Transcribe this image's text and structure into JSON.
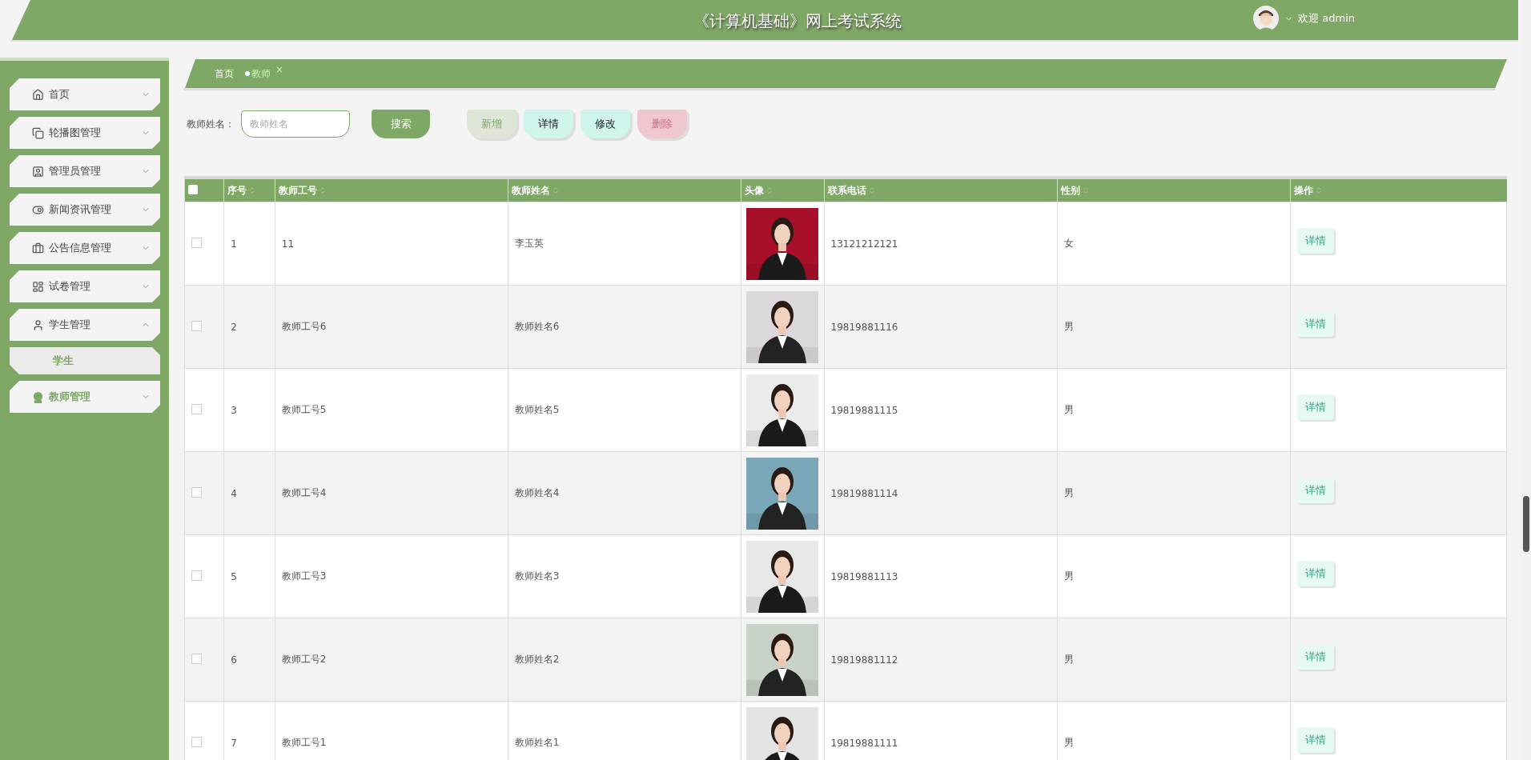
{
  "header": {
    "title": "《计算机基础》网上考试系统",
    "greeting": "欢迎 admin"
  },
  "sidebar": {
    "items": [
      {
        "label": "首页",
        "expanded": false,
        "selected": false
      },
      {
        "label": "轮播图管理",
        "expanded": false,
        "selected": false
      },
      {
        "label": "管理员管理",
        "expanded": false,
        "selected": false
      },
      {
        "label": "新闻资讯管理",
        "expanded": false,
        "selected": false
      },
      {
        "label": "公告信息管理",
        "expanded": false,
        "selected": false
      },
      {
        "label": "试卷管理",
        "expanded": false,
        "selected": false
      },
      {
        "label": "学生管理",
        "expanded": true,
        "selected": false,
        "children": [
          {
            "label": "学生",
            "selected": true
          }
        ]
      },
      {
        "label": "教师管理",
        "expanded": false,
        "selected": true
      }
    ]
  },
  "breadcrumb": [
    {
      "label": "首页",
      "selected": false
    },
    {
      "label": "教师",
      "selected": true,
      "close": "×"
    }
  ],
  "search": {
    "label": "教师姓名：",
    "placeholder": "教师姓名",
    "button": "搜索"
  },
  "actions": [
    {
      "label": "新增",
      "kind": "add"
    },
    {
      "label": "详情",
      "kind": "detail"
    },
    {
      "label": "修改",
      "kind": "edit"
    },
    {
      "label": "删除",
      "kind": "delete"
    }
  ],
  "table": {
    "all_checked": false,
    "columns": [
      "序号",
      "教师工号",
      "教师姓名",
      "头像",
      "联系电话",
      "性别",
      "操作"
    ],
    "rows": [
      {
        "index": "1",
        "id": "11",
        "name": "李玉英",
        "phone": "13121212121",
        "gender": "女",
        "action": "详情",
        "checked": false
      },
      {
        "index": "2",
        "id": "教师工号6",
        "name": "教师姓名6",
        "phone": "19819881116",
        "gender": "男",
        "action": "详情",
        "checked": false
      },
      {
        "index": "3",
        "id": "教师工号5",
        "name": "教师姓名5",
        "phone": "19819881115",
        "gender": "男",
        "action": "详情",
        "checked": false
      },
      {
        "index": "4",
        "id": "教师工号4",
        "name": "教师姓名4",
        "phone": "19819881114",
        "gender": "男",
        "action": "详情",
        "checked": false
      },
      {
        "index": "5",
        "id": "教师工号3",
        "name": "教师姓名3",
        "phone": "19819881113",
        "gender": "男",
        "action": "详情",
        "checked": false
      },
      {
        "index": "6",
        "id": "教师工号2",
        "name": "教师姓名2",
        "phone": "19819881112",
        "gender": "男",
        "action": "详情",
        "checked": false
      },
      {
        "index": "7",
        "id": "教师工号1",
        "name": "教师姓名1",
        "phone": "19819881111",
        "gender": "男",
        "action": "详情",
        "checked": false
      }
    ]
  }
}
